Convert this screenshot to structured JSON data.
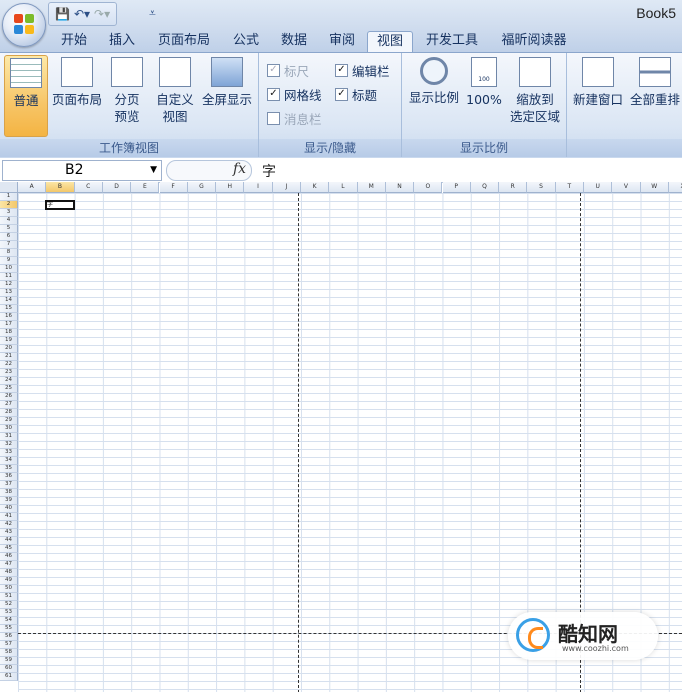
{
  "title": "Book5",
  "tabs": [
    {
      "label": "开始"
    },
    {
      "label": "插入"
    },
    {
      "label": "页面布局"
    },
    {
      "label": "公式"
    },
    {
      "label": "数据"
    },
    {
      "label": "审阅"
    },
    {
      "label": "视图",
      "active": true
    },
    {
      "label": "开发工具"
    },
    {
      "label": "福昕阅读器"
    }
  ],
  "ribbon": {
    "workbook_views": {
      "label": "工作簿视图",
      "normal": "普通",
      "page_layout": "页面布局",
      "page_break_l1": "分页",
      "page_break_l2": "预览",
      "custom_l1": "自定义",
      "custom_l2": "视图",
      "fullscreen": "全屏显示"
    },
    "show_hide": {
      "label": "显示/隐藏",
      "ruler": "标尺",
      "formula_bar": "编辑栏",
      "gridlines": "网格线",
      "headings": "标题",
      "message_bar": "消息栏"
    },
    "zoom": {
      "label": "显示比例",
      "zoom": "显示比例",
      "hundred": "100%",
      "selection_l1": "缩放到",
      "selection_l2": "选定区域",
      "hundred_badge": "100"
    },
    "window": {
      "new_window": "新建窗口",
      "arrange_all": "全部重排"
    }
  },
  "namebox": "B2",
  "fx": "fx",
  "formula_content": "字",
  "columns": [
    "A",
    "B",
    "C",
    "D",
    "E",
    "F",
    "G",
    "H",
    "I",
    "J",
    "K",
    "L",
    "M",
    "N",
    "O",
    "P",
    "Q",
    "R",
    "S",
    "T",
    "U",
    "V",
    "W",
    "X"
  ],
  "rows": [
    "1",
    "2",
    "3",
    "4",
    "5",
    "6",
    "7",
    "8",
    "9",
    "10",
    "11",
    "12",
    "13",
    "14",
    "15",
    "16",
    "17",
    "18",
    "19",
    "20",
    "21",
    "22",
    "23",
    "24",
    "25",
    "26",
    "27",
    "28",
    "29",
    "30",
    "31",
    "32",
    "33",
    "34",
    "35",
    "36",
    "37",
    "38",
    "39",
    "40",
    "41",
    "42",
    "43",
    "44",
    "45",
    "46",
    "47",
    "48",
    "49",
    "50",
    "51",
    "52",
    "53",
    "54",
    "55",
    "56",
    "57",
    "58",
    "59",
    "60",
    "61"
  ],
  "active_cell_text": "字",
  "watermark": {
    "name": "酷知网",
    "url": "www.coozhi.com"
  }
}
